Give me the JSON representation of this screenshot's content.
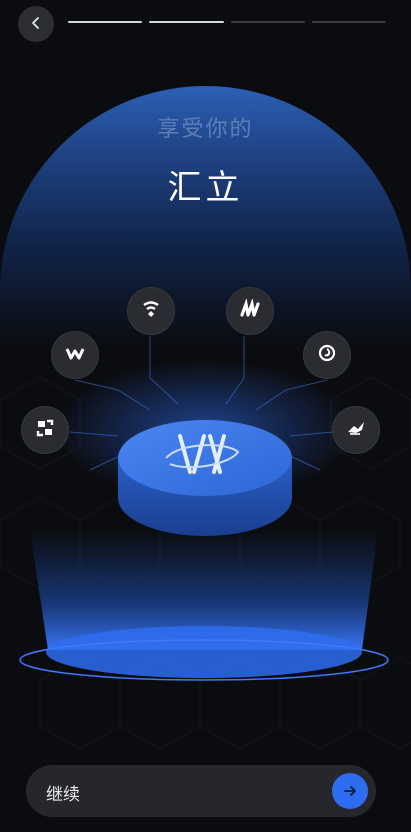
{
  "header": {
    "subtitle": "享受你的",
    "title": "汇立",
    "progress": {
      "total_steps": 4,
      "completed_steps": 2
    }
  },
  "back_button": {
    "icon": "chevron-left-icon"
  },
  "partner_icons": [
    {
      "name": "s-logo-icon"
    },
    {
      "name": "w-logo-icon"
    },
    {
      "name": "wifi-tag-logo-icon"
    },
    {
      "name": "m-logo-icon"
    },
    {
      "name": "swirl-logo-icon"
    },
    {
      "name": "bird-logo-icon"
    }
  ],
  "center_logo": {
    "icon": "hl-monogram-icon"
  },
  "colors": {
    "accent": "#2f6df0",
    "dome": "#2c5fb5",
    "background": "#0b0c10"
  },
  "footer": {
    "continue_label": "继续",
    "arrow_icon": "arrow-right-icon"
  }
}
